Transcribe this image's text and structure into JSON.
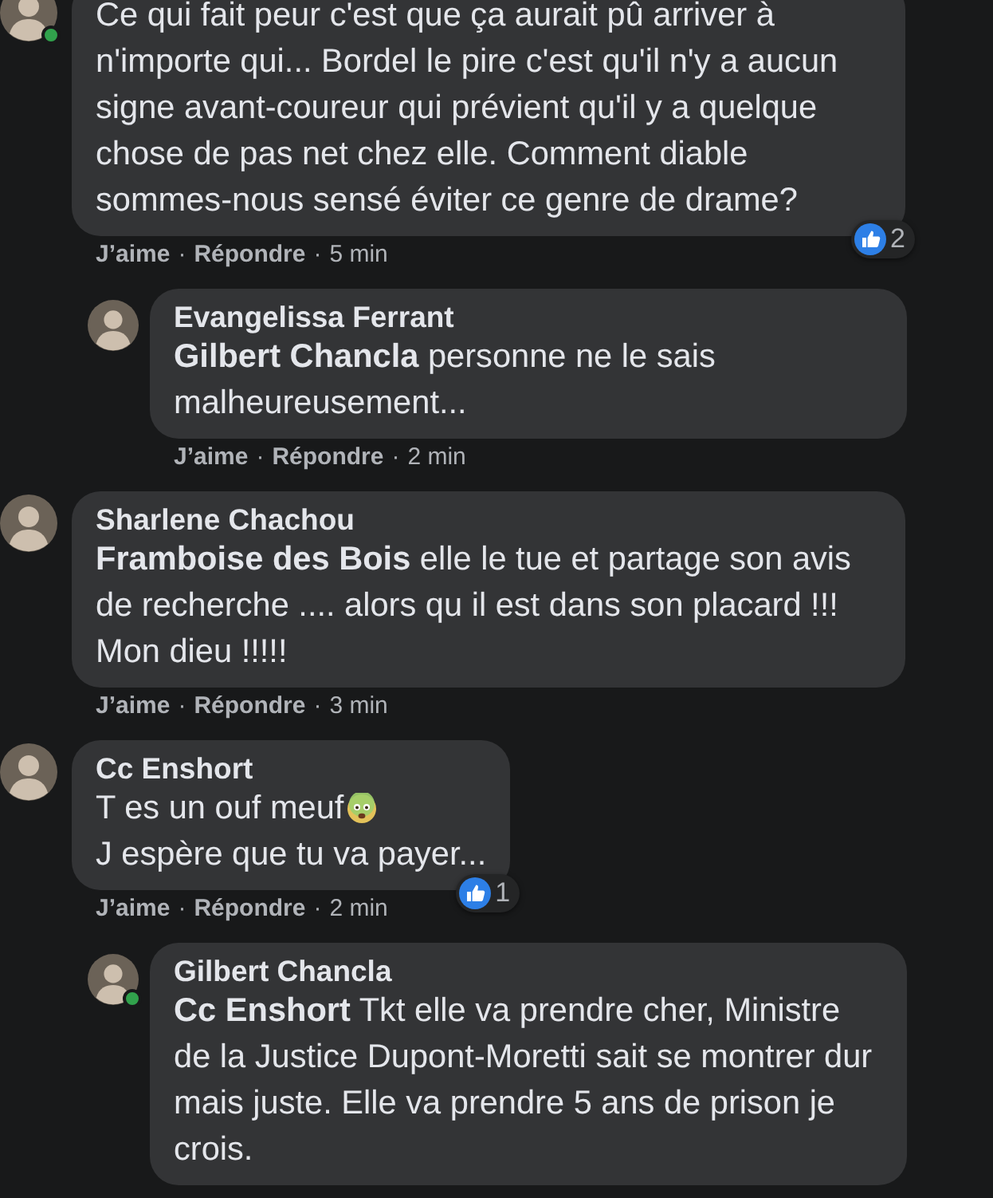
{
  "comments": [
    {
      "online": true,
      "body": [
        {
          "text": "Ce qui fait peur c'est que ça aurait pû arriver à n'importe qui... Bordel le pire c'est qu'il n'y a aucun signe avant-coureur qui prévient qu'il y a quelque chose de pas net chez elle. Comment diable sommes-nous sensé éviter ce genre de drame?",
          "emoji": false
        }
      ],
      "actions": {
        "separator": "·",
        "items": [
          {
            "kind": "link",
            "text": "J’aime"
          },
          {
            "kind": "link",
            "text": "Répondre"
          },
          {
            "kind": "time",
            "text": "5 min"
          }
        ]
      },
      "reactions": {
        "count": "2"
      },
      "children": [
        {
          "author": "Evangelissa Ferrant",
          "online": false,
          "body": [
            {
              "text": "**Gilbert Chancla** personne ne le sais malheureusement...",
              "emoji": false
            }
          ],
          "actions": {
            "separator": "·",
            "items": [
              {
                "kind": "link",
                "text": "J’aime"
              },
              {
                "kind": "link",
                "text": "Répondre"
              },
              {
                "kind": "time",
                "text": "2 min"
              }
            ]
          }
        }
      ]
    },
    {
      "author": "Sharlene Chachou",
      "online": false,
      "body": [
        {
          "text": "**Framboise des Bois** elle le tue et partage son avis de recherche .... alors qu il est dans son placard !!! Mon dieu !!!!!",
          "emoji": false
        }
      ],
      "actions": {
        "separator": "·",
        "items": [
          {
            "kind": "link",
            "text": "J’aime"
          },
          {
            "kind": "link",
            "text": "Répondre"
          },
          {
            "kind": "time",
            "text": "3 min"
          }
        ]
      }
    },
    {
      "author": "Cc Enshort",
      "online": false,
      "body": [
        {
          "text": "T es un ouf meuf",
          "emoji": true
        },
        {
          "text": "J espère que tu va payer...",
          "emoji": false
        }
      ],
      "actions": {
        "separator": "·",
        "items": [
          {
            "kind": "link",
            "text": "J’aime"
          },
          {
            "kind": "link",
            "text": "Répondre"
          },
          {
            "kind": "time",
            "text": "2 min"
          }
        ]
      },
      "reactions": {
        "count": "1"
      },
      "children": [
        {
          "author": "Gilbert Chancla",
          "online": true,
          "body": [
            {
              "text": "**Cc Enshort** Tkt elle va prendre cher, Ministre de la Justice Dupont-Moretti sait se montrer dur mais juste. Elle va prendre 5 ans de prison je crois.",
              "emoji": false
            }
          ]
        }
      ]
    }
  ]
}
